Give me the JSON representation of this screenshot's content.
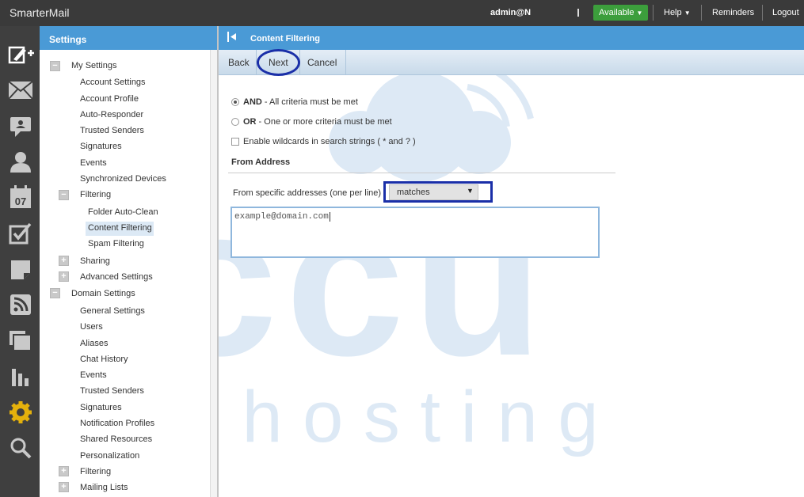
{
  "topbar": {
    "brand": "SmarterMail",
    "user": "admin@N",
    "status_button": "Available",
    "help": "Help",
    "reminders": "Reminders",
    "logout": "Logout"
  },
  "nav_icons": [
    "compose-icon",
    "mail-icon",
    "chat-icon",
    "contacts-icon",
    "calendar-icon",
    "tasks-icon",
    "notes-icon",
    "rss-icon",
    "files-icon",
    "reports-icon",
    "settings-icon",
    "search-icon"
  ],
  "calendar_day": "07",
  "sidebar": {
    "title": "Settings",
    "my_settings": "My Settings",
    "account_settings": "Account Settings",
    "account_profile": "Account Profile",
    "auto_responder": "Auto-Responder",
    "trusted_senders": "Trusted Senders",
    "signatures": "Signatures",
    "events": "Events",
    "synchronized_devices": "Synchronized Devices",
    "filtering": "Filtering",
    "folder_auto_clean": "Folder Auto-Clean",
    "content_filtering": "Content Filtering",
    "spam_filtering": "Spam Filtering",
    "sharing": "Sharing",
    "advanced_settings": "Advanced Settings",
    "domain_settings": "Domain Settings",
    "general_settings": "General Settings",
    "users": "Users",
    "aliases": "Aliases",
    "chat_history": "Chat History",
    "events2": "Events",
    "trusted_senders2": "Trusted Senders",
    "signatures2": "Signatures",
    "notification_profiles": "Notification Profiles",
    "shared_resources": "Shared Resources",
    "personalization": "Personalization",
    "filtering2": "Filtering",
    "mailing_lists": "Mailing Lists"
  },
  "main": {
    "title": "Content Filtering",
    "back": "Back",
    "next": "Next",
    "cancel": "Cancel",
    "and_bold": "AND",
    "and_rest": " - All criteria must be met",
    "or_bold": "OR",
    "or_rest": " - One or more criteria must be met",
    "wildcards": "Enable wildcards in search strings ( * and ? )",
    "section": "From Address",
    "from_label": "From specific addresses (one per line)",
    "select_value": "matches",
    "addresses": "example@domain.com"
  },
  "watermark": {
    "big": "accu",
    "small": "w e b   h o s t i n g"
  },
  "colors": {
    "header_blue": "#4a9ad6",
    "available_green": "#3c9e3c",
    "annotation_blue": "#1a2fa8",
    "watermark": "#dbe8f4"
  }
}
